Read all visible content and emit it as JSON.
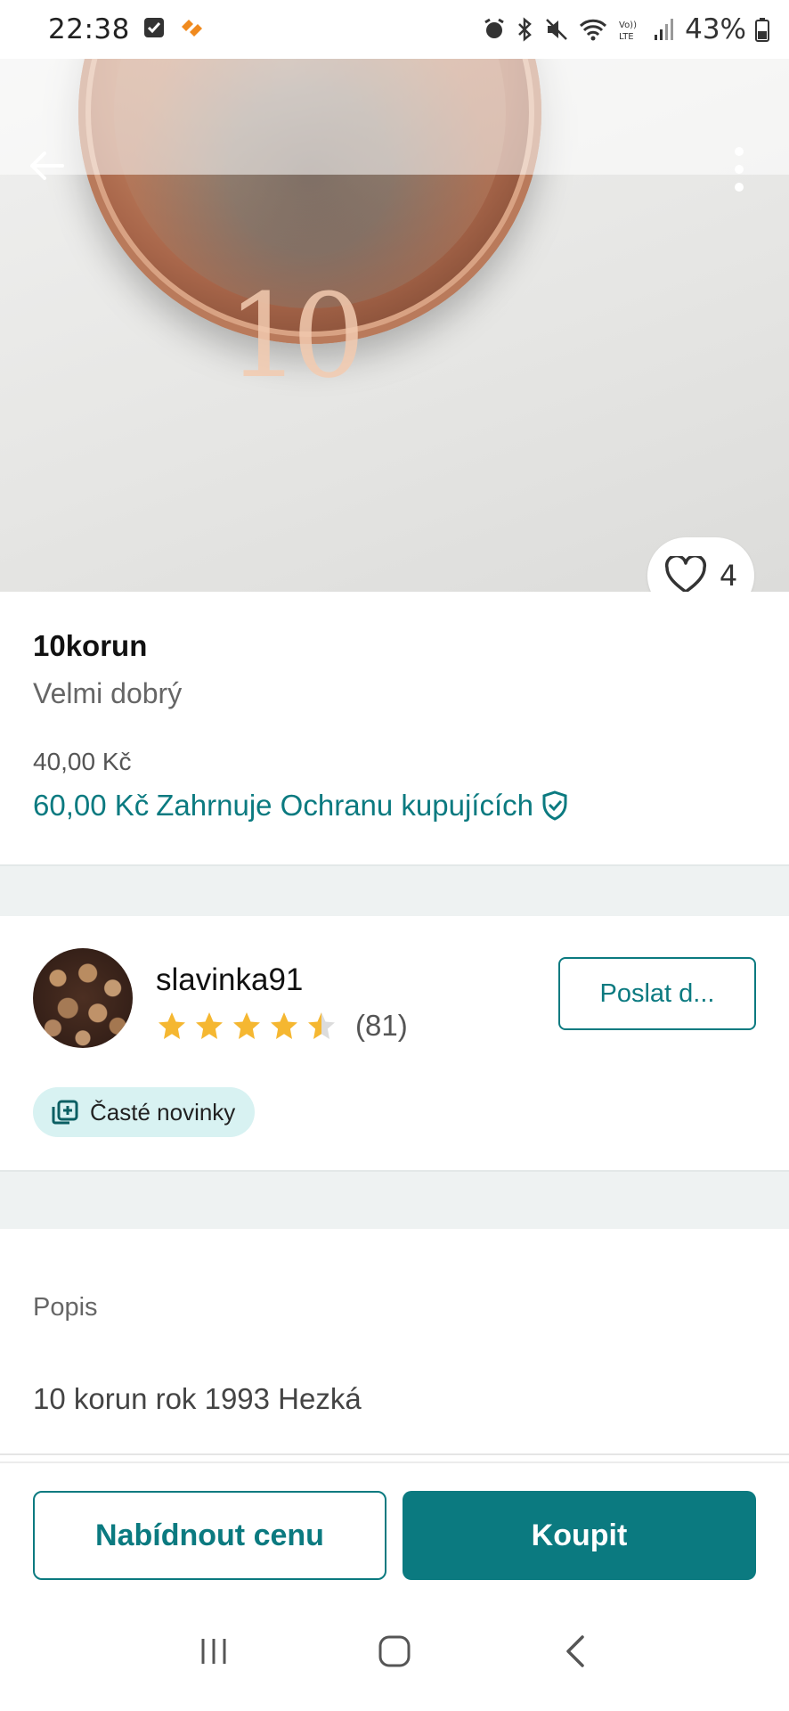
{
  "status_bar": {
    "time": "22:38",
    "battery": "43%",
    "icons": [
      "checkbox-notification-icon",
      "hearts-notification-icon",
      "alarm-icon",
      "bluetooth-icon",
      "mute-icon",
      "wifi-icon",
      "volte-icon",
      "signal-icon",
      "battery-icon"
    ]
  },
  "photo": {
    "like_count": "4"
  },
  "product": {
    "title": "10korun",
    "condition": "Velmi dobrý",
    "price": "40,00 Kč",
    "total_price": "60,00 Kč",
    "protection_label": "Zahrnuje Ochranu kupujících"
  },
  "seller": {
    "name": "slavinka91",
    "rating": 4.5,
    "reviews": "(81)",
    "message_button": "Poslat d...",
    "badge": "Časté novinky"
  },
  "description": {
    "label": "Popis",
    "text": "10 korun rok 1993 Hezká"
  },
  "actions": {
    "offer_label": "Nabídnout cenu",
    "buy_label": "Koupit"
  },
  "colors": {
    "accent": "#0b7a80",
    "star": "#f5b731",
    "badge_bg": "#d8f2f2",
    "divider_bg": "#eef2f2"
  }
}
